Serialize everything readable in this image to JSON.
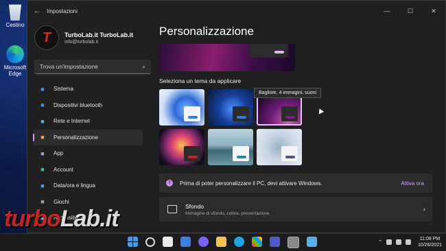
{
  "desktop": {
    "icons": [
      {
        "label": "Cestino",
        "icon": "recycle-bin-icon"
      },
      {
        "label": "Microsoft Edge",
        "icon": "edge-icon"
      }
    ]
  },
  "window": {
    "title": "Impostazioni",
    "controls": [
      "—",
      "☐",
      "✕"
    ]
  },
  "profile": {
    "name": "TurboLab.it TurboLab.it",
    "email": "info@turbolab.it",
    "avatar_letter": "T"
  },
  "search": {
    "placeholder": "Trova un'impostazione"
  },
  "nav": [
    {
      "label": "Sistema",
      "icon": "monitor-icon",
      "color": "#3a8ee6"
    },
    {
      "label": "Dispositivi bluetooth",
      "icon": "bluetooth-icon",
      "color": "#3a8ee6"
    },
    {
      "label": "Rete e Internet",
      "icon": "network-icon",
      "color": "#4db0f0"
    },
    {
      "label": "Personalizzazione",
      "icon": "brush-icon",
      "color": "#f0a25a",
      "active": true
    },
    {
      "label": "App",
      "icon": "apps-icon",
      "color": "#8aa6c8"
    },
    {
      "label": "Account",
      "icon": "account-icon",
      "color": "#3fbf8f"
    },
    {
      "label": "Data/ora e lingua",
      "icon": "globe-icon",
      "color": "#4aa3e0"
    },
    {
      "label": "Giochi",
      "icon": "gamepad-icon",
      "color": "#9aa0a6"
    },
    {
      "label": "Accessibilità",
      "icon": "accessibility-icon",
      "color": "#6aa8e8"
    }
  ],
  "main": {
    "title": "Personalizzazione",
    "themes_label": "Seleziona un tema da applicare",
    "themes": [
      {
        "name": "theme-1",
        "bar_color": "#2f7fe0",
        "card_color": "#f2f4f8"
      },
      {
        "name": "theme-2",
        "bar_color": "#2f7fe0",
        "card_color": "#2b2b2b"
      },
      {
        "name": "theme-3",
        "bar_color": "#7a1f86",
        "card_color": "#2b2b2b",
        "selected": true
      },
      {
        "name": "theme-4",
        "bar_color": "#d01f2b",
        "card_color": "#2b2b2b"
      },
      {
        "name": "theme-5",
        "bar_color": "#2e8a9a",
        "card_color": "#f2f4f8"
      },
      {
        "name": "theme-6",
        "bar_color": "#4a5b73",
        "card_color": "#f2f4f8"
      }
    ],
    "tooltip": "Bagliore, 4 immagini, suoni",
    "notice": {
      "message": "Prima di poter personalizzare il PC, devi attivare Windows.",
      "action": "Attiva ora"
    },
    "settings": [
      {
        "title": "Sfondo",
        "subtitle": "Immagine di sfondo, colore, presentazione"
      }
    ]
  },
  "watermark": {
    "part1": "turbo",
    "part2": "Lab.it"
  },
  "taskbar": {
    "time": "11:08 PM",
    "date": "10/26/2021",
    "tray_chevron": "⌃"
  }
}
